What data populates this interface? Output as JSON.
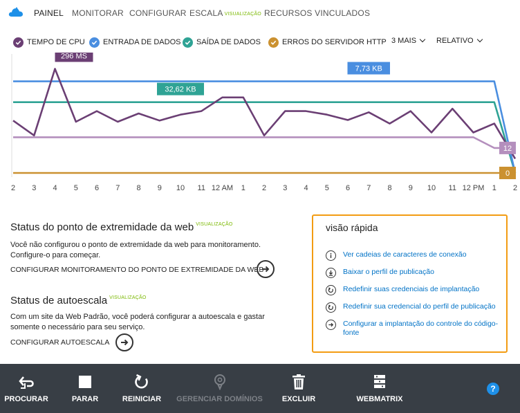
{
  "nav": {
    "tabs": [
      {
        "label": "PAINEL"
      },
      {
        "label": "MONITORAR"
      },
      {
        "label": "CONFIGURAR"
      },
      {
        "label": "ESCALA",
        "badge": "VISUALIZAÇÃO"
      },
      {
        "label": "RECURSOS VINCULADOS"
      }
    ]
  },
  "legend": {
    "items": [
      {
        "label": "TEMPO DE CPU",
        "color": "#6b3f74"
      },
      {
        "label": "ENTRADA DE DADOS",
        "color": "#4a8ee0"
      },
      {
        "label": "SAÍDA DE DADOS",
        "color": "#2fa395"
      },
      {
        "label": "ERROS DO SERVIDOR HTTP",
        "color": "#cb9130"
      }
    ],
    "more": "3 MAIS",
    "mode": "RELATIVO"
  },
  "chart_data": {
    "type": "line",
    "x": [
      "2",
      "3",
      "4",
      "5",
      "6",
      "7",
      "8",
      "9",
      "10",
      "11",
      "12 AM",
      "1",
      "2",
      "3",
      "4",
      "5",
      "6",
      "7",
      "8",
      "9",
      "10",
      "11",
      "12 PM",
      "1",
      "2"
    ],
    "series": [
      {
        "name": "TEMPO DE CPU",
        "color": "#6b3f74",
        "values": [
          8.8,
          6.3,
          17.5,
          8.6,
          10.4,
          8.6,
          10.0,
          8.8,
          9.8,
          10.4,
          12.7,
          12.7,
          6.3,
          10.4,
          10.4,
          9.8,
          8.9,
          10.2,
          8.3,
          10.4,
          6.8,
          10.8,
          6.8,
          8.3,
          2.4
        ],
        "callout": {
          "index": 2,
          "text": "296 MS"
        }
      },
      {
        "name": "ENTRADA DE DADOS",
        "color": "#4a8ee0",
        "values": [
          15.4,
          15.4,
          15.4,
          15.4,
          15.4,
          15.4,
          15.4,
          15.4,
          15.4,
          15.4,
          15.4,
          15.4,
          15.4,
          15.4,
          15.4,
          15.4,
          15.4,
          15.4,
          15.4,
          15.4,
          15.4,
          15.4,
          15.4,
          15.4,
          0
        ],
        "callout": {
          "index": 17,
          "text": "7,73 KB"
        }
      },
      {
        "name": "SAÍDA DE DADOS",
        "color": "#2fa395",
        "values": [
          11.9,
          11.9,
          11.9,
          11.9,
          11.9,
          11.9,
          11.9,
          11.9,
          11.9,
          11.9,
          11.9,
          11.9,
          11.9,
          11.9,
          11.9,
          11.9,
          11.9,
          11.9,
          11.9,
          11.9,
          11.9,
          11.9,
          11.9,
          11.9,
          0
        ],
        "callout": {
          "index": 8,
          "text": "32,62 KB"
        }
      },
      {
        "name": "",
        "color": "#b48fbd",
        "values": [
          6.0,
          6.0,
          6.0,
          6.0,
          6.0,
          6.0,
          6.0,
          6.0,
          6.0,
          6.0,
          6.0,
          6.0,
          6.0,
          6.0,
          6.0,
          6.0,
          6.0,
          6.0,
          6.0,
          6.0,
          6.0,
          6.0,
          6.0,
          4.2,
          4.2
        ],
        "end_label": "12"
      },
      {
        "name": "ERROS DO SERVIDOR HTTP",
        "color": "#cb9130",
        "values": [
          0,
          0,
          0,
          0,
          0,
          0,
          0,
          0,
          0,
          0,
          0,
          0,
          0,
          0,
          0,
          0,
          0,
          0,
          0,
          0,
          0,
          0,
          0,
          0,
          0
        ],
        "end_label": "0"
      }
    ],
    "ylim": [
      0,
      20
    ],
    "grid": false
  },
  "endpoint": {
    "title": "Status do ponto de extremidade da web",
    "badge": "VISUALIZAÇÃO",
    "text": "Você não configurou o ponto de extremidade da web para monitoramento. Configure-o para começar.",
    "action": "CONFIGURAR MONITORAMENTO DO PONTO DE EXTREMIDADE DA WEB"
  },
  "autoscale": {
    "title": "Status de autoescala",
    "badge": "VISUALIZAÇÃO",
    "text": "Com um site da Web Padrão, você poderá configurar a autoescala e gastar somente o necessário para seu serviço.",
    "action": "CONFIGURAR AUTOESCALA"
  },
  "quickview": {
    "title": "visão rápida",
    "items": [
      {
        "label": "Ver cadeias de caracteres de conexão",
        "icon": "info-icon"
      },
      {
        "label": "Baixar o perfil de publicação",
        "icon": "download-icon"
      },
      {
        "label": "Redefinir suas credenciais de implantação",
        "icon": "reset-icon"
      },
      {
        "label": "Redefinir sua credencial do perfil de publicação",
        "icon": "reset-icon"
      },
      {
        "label": "Configurar a implantação do controle do código-fonte",
        "icon": "arrow-right-icon"
      }
    ]
  },
  "commands": [
    {
      "label": "PROCURAR",
      "icon": "browse-icon",
      "enabled": true
    },
    {
      "label": "PARAR",
      "icon": "stop-icon",
      "enabled": true
    },
    {
      "label": "REINICIAR",
      "icon": "restart-icon",
      "enabled": true
    },
    {
      "label": "GERENCIAR DOMÍNIOS",
      "icon": "domains-icon",
      "enabled": false
    },
    {
      "label": "EXCLUIR",
      "icon": "trash-icon",
      "enabled": true
    },
    {
      "label": "WEBMATRIX",
      "icon": "webmatrix-icon",
      "enabled": true
    }
  ],
  "help_label": "?"
}
